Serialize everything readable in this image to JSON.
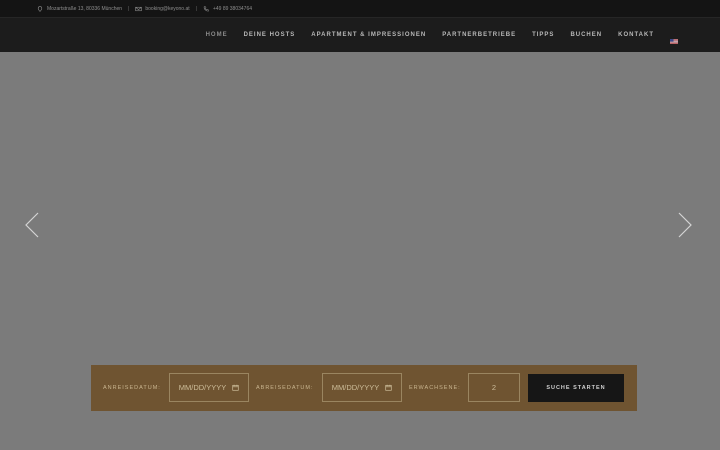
{
  "topbar": {
    "address": "Mozartstraße 13, 80336 München",
    "email": "booking@keyono.at",
    "phone": "+49 89 38034764",
    "separator": "|"
  },
  "nav": {
    "items": [
      {
        "label": "HOME",
        "active": true
      },
      {
        "label": "DEINE HOSTS"
      },
      {
        "label": "APARTMENT & IMPRESSIONEN"
      },
      {
        "label": "PARTNERBETRIEBE"
      },
      {
        "label": "TIPPS"
      },
      {
        "label": "BUCHEN"
      },
      {
        "label": "KONTAKT"
      }
    ],
    "language_icon": "us-flag-icon"
  },
  "slider": {
    "prev_icon": "chevron-left-icon",
    "next_icon": "chevron-right-icon"
  },
  "booking": {
    "arrival_label": "ANREISEDATUM:",
    "arrival_value": "MM/DD/YYYY",
    "departure_label": "ABREISEDATUM:",
    "departure_value": "MM/DD/YYYY",
    "adults_label": "ERWACHSENE:",
    "adults_value": "2",
    "submit_label": "SUCHE STARTEN"
  },
  "colors": {
    "topbar_bg": "#141414",
    "navbar_bg": "#1c1c1c",
    "slider_bg": "#7b7b7b",
    "booking_bg": "#6f5431",
    "button_bg": "#161616"
  }
}
